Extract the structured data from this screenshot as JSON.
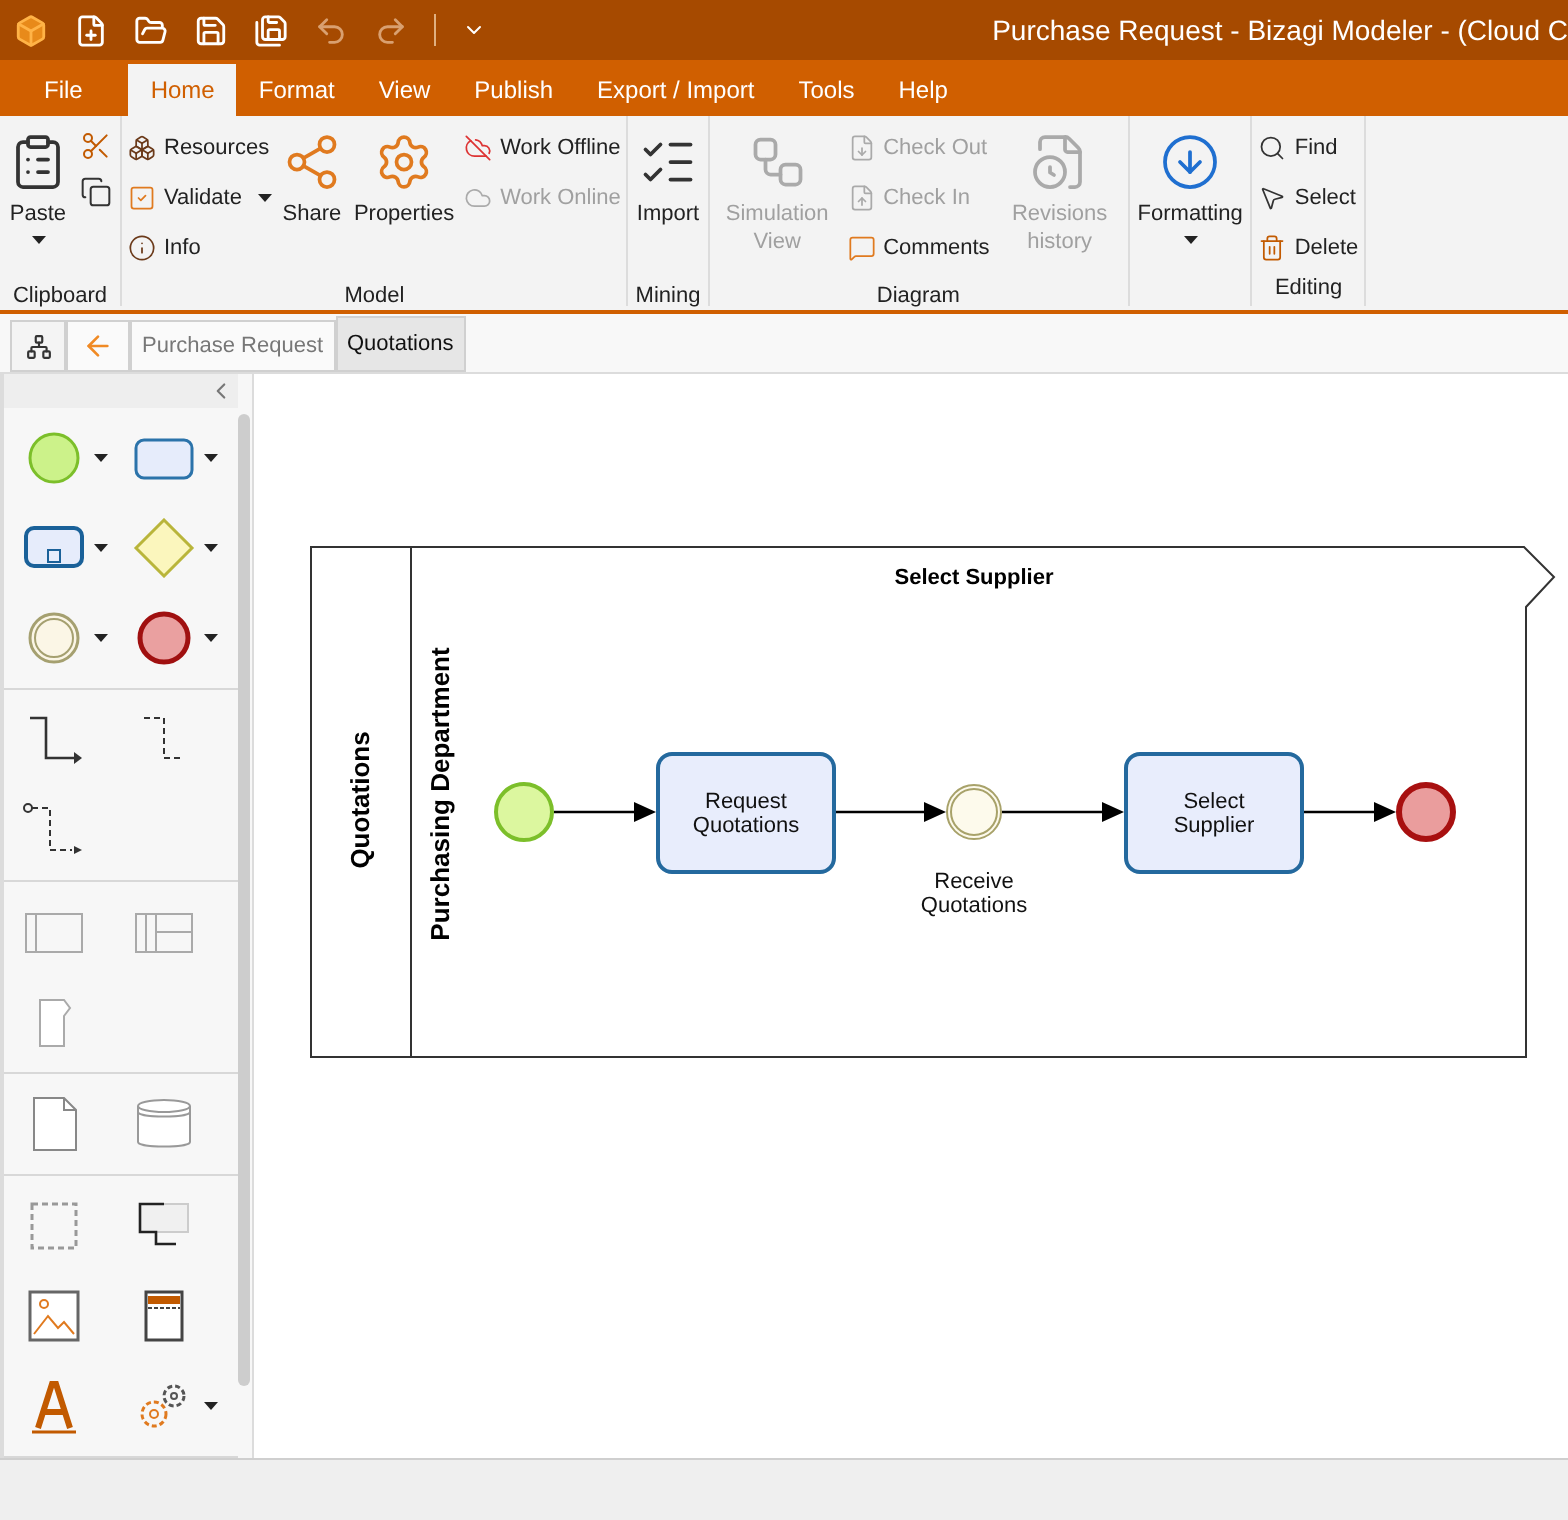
{
  "window": {
    "title": "Purchase Request - Bizagi Modeler - (Cloud C"
  },
  "menu_tabs": [
    {
      "label": "File",
      "selected": false,
      "kind": "file"
    },
    {
      "label": "Home",
      "selected": true
    },
    {
      "label": "Format",
      "selected": false
    },
    {
      "label": "View",
      "selected": false
    },
    {
      "label": "Publish",
      "selected": false
    },
    {
      "label": "Export / Import",
      "selected": false
    },
    {
      "label": "Tools",
      "selected": false
    },
    {
      "label": "Help",
      "selected": false
    }
  ],
  "ribbon": [
    {
      "label": "Clipboard",
      "items": [
        {
          "kind": "large",
          "label": "Paste",
          "dropdown": true,
          "disabled": false
        },
        {
          "kind": "icon"
        },
        {
          "kind": "icon"
        }
      ]
    },
    {
      "label": "Model",
      "items": [
        {
          "kind": "small",
          "label": "Resources",
          "disabled": false
        },
        {
          "kind": "small",
          "label": "Validate",
          "dropdown": true,
          "disabled": false
        },
        {
          "kind": "small",
          "label": "Info",
          "disabled": false
        },
        {
          "kind": "large",
          "label": "Share",
          "disabled": false
        },
        {
          "kind": "large",
          "label": "Properties",
          "disabled": false
        },
        {
          "kind": "small",
          "label": "Work Offline",
          "disabled": false
        },
        {
          "kind": "small",
          "label": "Work Online",
          "disabled": true
        }
      ]
    },
    {
      "label": "Mining",
      "items": [
        {
          "kind": "large",
          "label": "Import",
          "disabled": false
        }
      ]
    },
    {
      "label": "Diagram",
      "items": [
        {
          "kind": "large",
          "label": "Simulation View",
          "disabled": true
        },
        {
          "kind": "small",
          "label": "Check Out",
          "disabled": true
        },
        {
          "kind": "small",
          "label": "Check In",
          "disabled": true
        },
        {
          "kind": "small",
          "label": "Comments",
          "disabled": false
        },
        {
          "kind": "large",
          "label": "Revisions history",
          "disabled": true
        }
      ]
    },
    {
      "items": [
        {
          "kind": "large",
          "label": "Formatting",
          "dropdown": true,
          "disabled": false
        }
      ]
    },
    {
      "label": "Editing",
      "items": [
        {
          "kind": "small",
          "label": "Find",
          "disabled": false
        },
        {
          "kind": "small",
          "label": "Select",
          "disabled": false
        },
        {
          "kind": "small",
          "label": "Delete",
          "disabled": false
        }
      ]
    }
  ],
  "doc_tabs": [
    {
      "label": "Purchase Request",
      "selected": false
    },
    {
      "label": "Quotations",
      "selected": true
    }
  ],
  "diagram": {
    "pool": "Quotations",
    "lane": "Purchasing Department",
    "phase": "Select Supplier",
    "nodes": [
      {
        "kind": "start"
      },
      {
        "kind": "task",
        "label": "Request Quotations"
      },
      {
        "kind": "intermediate",
        "label": "Receive Quotations"
      },
      {
        "kind": "task",
        "label": "Select Supplier"
      },
      {
        "kind": "end"
      }
    ]
  }
}
